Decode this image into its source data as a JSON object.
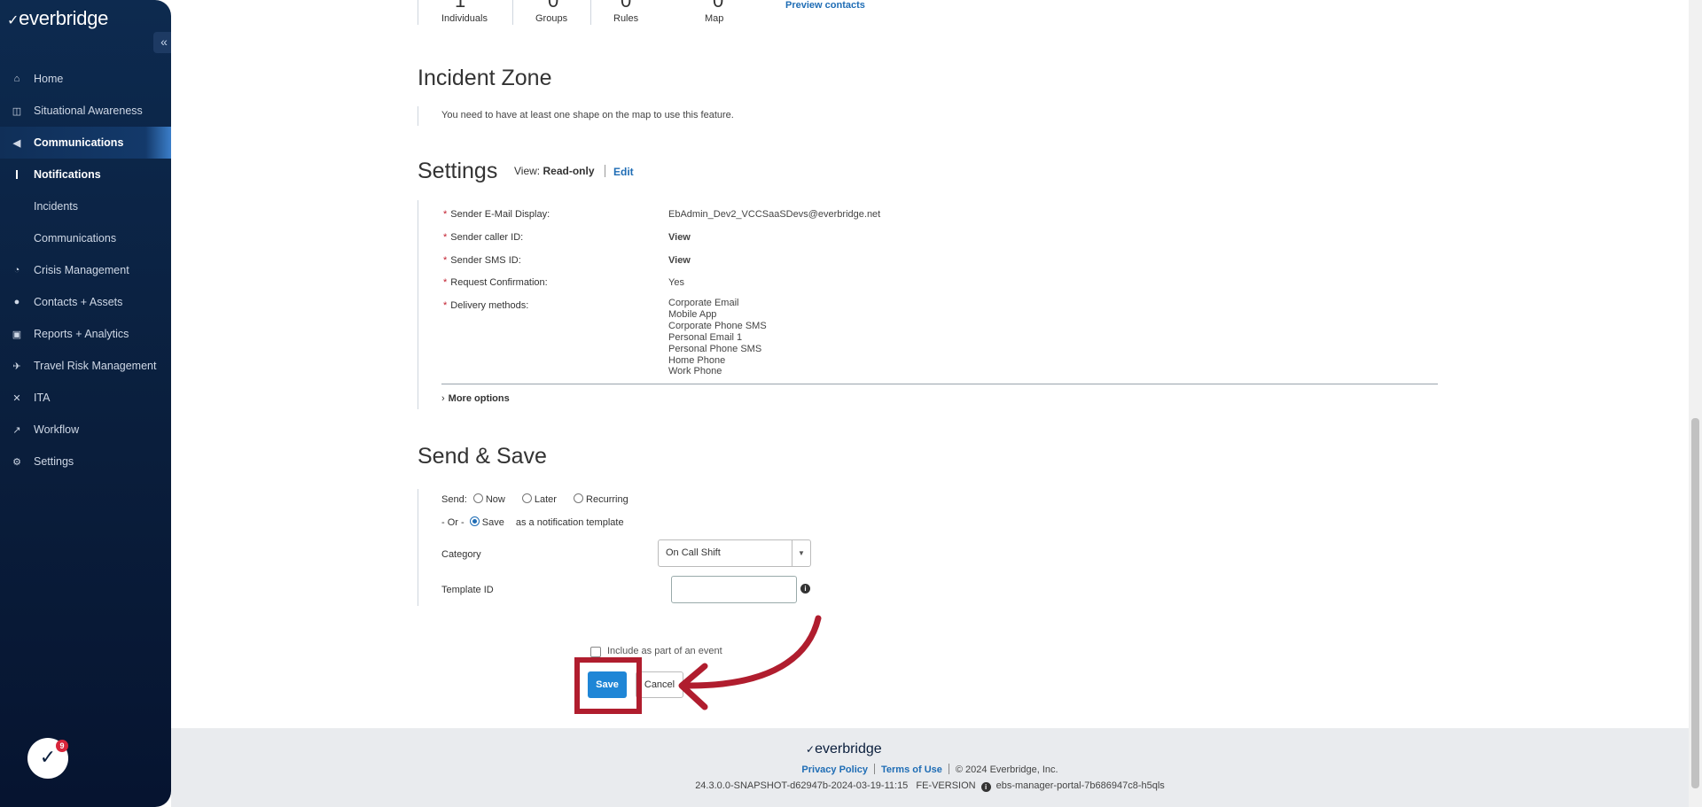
{
  "brand": {
    "logo_text": "everbridge"
  },
  "sidebar": {
    "collapse_icon": "«",
    "items": [
      {
        "label": "Home",
        "icon": "home-icon"
      },
      {
        "label": "Situational Awareness",
        "icon": "awareness-icon"
      },
      {
        "label": "Communications",
        "icon": "megaphone-icon"
      },
      {
        "label": "Crisis Management",
        "icon": "crisis-icon"
      },
      {
        "label": "Contacts + Assets",
        "icon": "location-pin-icon"
      },
      {
        "label": "Reports + Analytics",
        "icon": "report-icon"
      },
      {
        "label": "Travel Risk Management",
        "icon": "plane-icon"
      },
      {
        "label": "ITA",
        "icon": "ita-icon"
      },
      {
        "label": "Workflow",
        "icon": "workflow-icon"
      },
      {
        "label": "Settings",
        "icon": "gear-icon"
      }
    ],
    "sub_items": [
      {
        "label": "Notifications"
      },
      {
        "label": "Incidents"
      },
      {
        "label": "Communications"
      }
    ],
    "chat_badge_count": "9"
  },
  "recipients": {
    "stats": [
      {
        "label": "Individuals"
      },
      {
        "label": "Groups"
      },
      {
        "label": "Rules"
      },
      {
        "label": "Map"
      }
    ],
    "preview_link": "Preview contacts"
  },
  "incident_zone": {
    "title": "Incident Zone",
    "note": "You need to have at least one shape on the map to use this feature."
  },
  "settings": {
    "title": "Settings",
    "view_label": "View:",
    "view_mode": "Read-only",
    "edit_link": "Edit",
    "rows": [
      {
        "label": "Sender E-Mail Display:",
        "value": "EbAdmin_Dev2_VCCSaaSDevs@everbridge.net"
      },
      {
        "label": "Sender caller ID:",
        "value": "View"
      },
      {
        "label": "Sender SMS ID:",
        "value": "View"
      },
      {
        "label": "Request Confirmation:",
        "value": "Yes"
      },
      {
        "label": "Delivery methods:",
        "value": ""
      }
    ],
    "delivery_methods": [
      "Corporate Email",
      "Mobile App",
      "Corporate Phone SMS",
      "Personal Email 1",
      "Personal Phone SMS",
      "Home Phone",
      "Work Phone"
    ],
    "more_options": "More options"
  },
  "send_save": {
    "title": "Send & Save",
    "send_label": "Send:",
    "send_options": [
      "Now",
      "Later",
      "Recurring"
    ],
    "or_label": "- Or -",
    "save_option": "Save",
    "save_suffix": "as a notification template",
    "category_label": "Category",
    "category_value": "On Call Shift",
    "template_id_label": "Template ID",
    "template_id_value": "",
    "include_event_label": "Include as part of an event",
    "save_button": "Save",
    "cancel_button": "Cancel"
  },
  "footer": {
    "logo_text": "everbridge",
    "privacy": "Privacy Policy",
    "terms": "Terms of Use",
    "copyright": "© 2024 Everbridge, Inc.",
    "version": "24.3.0.0-SNAPSHOT-d62947b-2024-03-19-11:15",
    "fe_version_label": "FE-VERSION",
    "host": "ebs-manager-portal-7b686947c8-h5qls"
  },
  "colors": {
    "accent": "#1f6db5",
    "annotation": "#b01d2e",
    "sidebar_bg": "#0a1e3c"
  }
}
